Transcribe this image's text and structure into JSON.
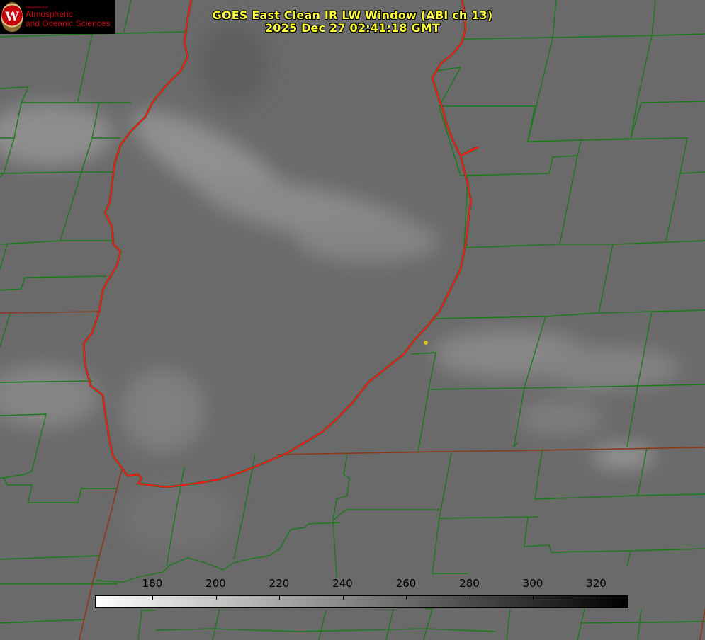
{
  "header": {
    "title_line1": "GOES East Clean IR LW Window (ABI ch 13)",
    "title_line2": "2025 Dec 27 02:41:18 GMT"
  },
  "logo": {
    "seal_letter": "W",
    "dept_text": "Department of",
    "line1": "Atmospheric",
    "line2": "and Oceanic Sciences"
  },
  "colorbar": {
    "ticks": [
      "180",
      "200",
      "220",
      "240",
      "260",
      "280",
      "300",
      "320"
    ],
    "colors": [
      "#ffffff",
      "#000000"
    ]
  },
  "colors": {
    "county_lines": "#1a7a1a",
    "lake_shore": "#ff1a1a",
    "state_line": "#8b3a1a",
    "marker": "#d6c21a",
    "title": "#ffff3a"
  }
}
